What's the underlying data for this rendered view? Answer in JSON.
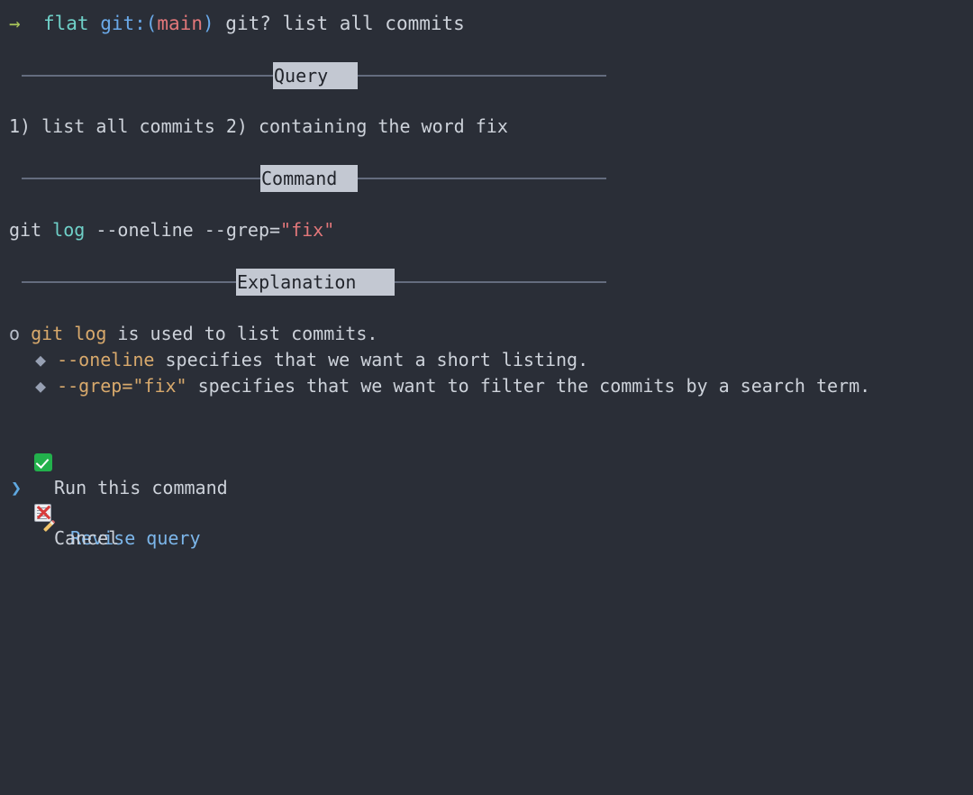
{
  "terminal": {
    "background_color": "#2a2e37",
    "foreground_color": "#cdd2da"
  },
  "prompt": {
    "arrow": "→",
    "directory": "flat",
    "git_open": "git:(",
    "git_branch": "main",
    "git_close": ")",
    "command": "git? list all commits"
  },
  "sections": [
    {
      "label": "Query"
    },
    {
      "label": "Command"
    },
    {
      "label": "Explanation"
    }
  ],
  "query": {
    "text": "1) list all commits 2) containing the word fix"
  },
  "command": {
    "program": "git",
    "subcommand": "log",
    "flags": " --oneline --grep=",
    "value": "\"fix\""
  },
  "explanation": {
    "bullets": [
      {
        "marker": "o",
        "code": "git log",
        "text": " is used to list commits."
      },
      {
        "marker": "◆",
        "code": "--oneline",
        "text": " specifies that we want a short listing."
      },
      {
        "marker": "◆",
        "code": "--grep=\"fix\"",
        "text": " specifies that we want to filter the commits by a search term."
      }
    ]
  },
  "menu": {
    "pointer": "❯",
    "selected_index": 1,
    "items": [
      {
        "icon": "white-heavy-check-mark",
        "label": "Run this command",
        "selected": false
      },
      {
        "icon": "memo",
        "label": "Revise query",
        "selected": true
      },
      {
        "icon": "cross-mark",
        "label": "Cancel",
        "selected": false
      }
    ]
  },
  "colors": {
    "accent_green": "#a9c65a",
    "accent_cyan": "#6fd0c8",
    "accent_blue": "#7cb6ea",
    "accent_red": "#e2777a",
    "accent_orange": "#d8a96c",
    "rule": "#646c7e",
    "label_bg": "#c3c8d2"
  }
}
